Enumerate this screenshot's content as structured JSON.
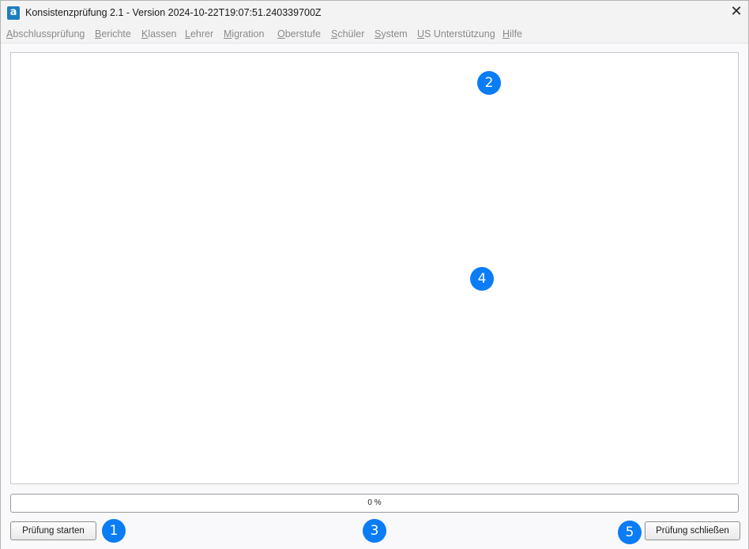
{
  "window": {
    "title": "Konsistenzprüfung 2.1 - Version 2024-10-22T19:07:51.240339700Z",
    "app_icon": "a",
    "close_icon": "✕"
  },
  "menu": {
    "items": [
      {
        "underline": "A",
        "rest": "bschlussprüfung"
      },
      {
        "underline": "B",
        "rest": "erichte"
      },
      {
        "underline": "K",
        "rest": "lassen"
      },
      {
        "underline": "L",
        "rest": "ehrer"
      },
      {
        "underline": "M",
        "rest": "igration"
      },
      {
        "underline": "O",
        "rest": "berstufe"
      },
      {
        "underline": "S",
        "rest": "chüler"
      },
      {
        "underline": "S",
        "rest": "ystem"
      },
      {
        "underline": "U",
        "rest": "S Unterstützung"
      },
      {
        "underline": "H",
        "rest": "ilfe"
      }
    ]
  },
  "progress": {
    "label": "0 %",
    "value": 0,
    "fill_color": "#06b025"
  },
  "buttons": {
    "start_label": "Prüfung starten",
    "close_label": "Prüfung schließen"
  },
  "badges": [
    "1",
    "2",
    "3",
    "4",
    "5"
  ],
  "colors": {
    "badge": "#0a7cf5"
  }
}
